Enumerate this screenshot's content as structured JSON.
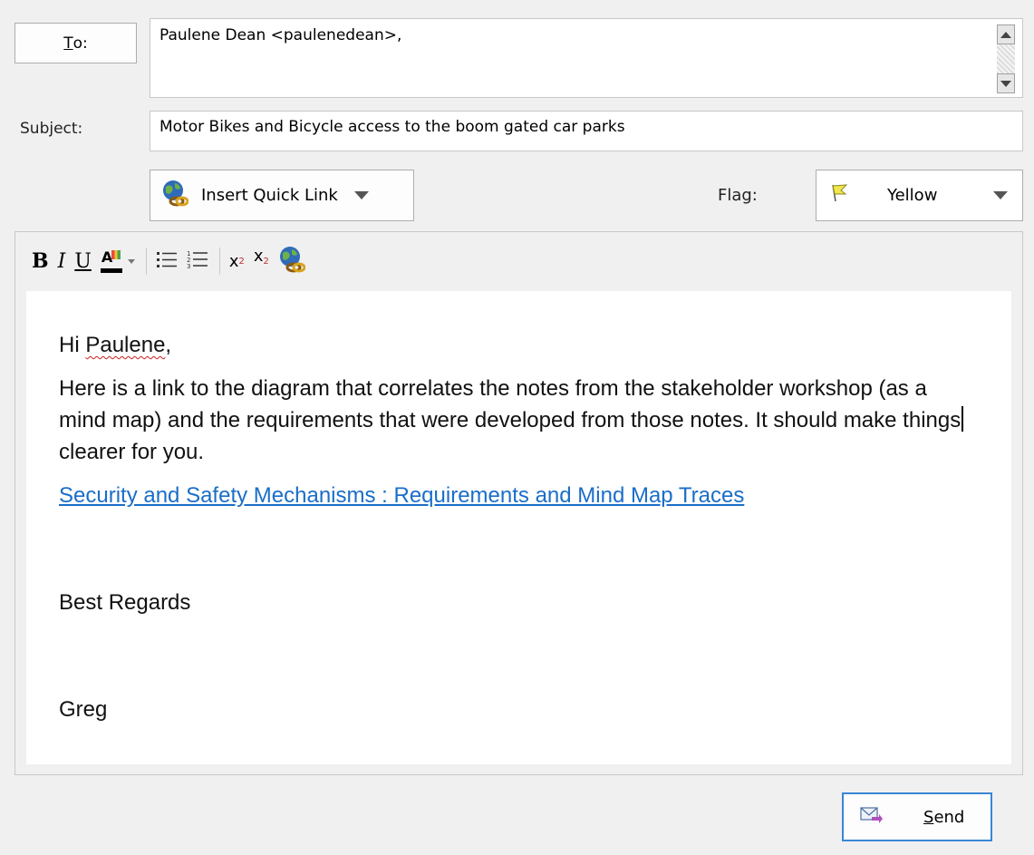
{
  "recipients": {
    "to_button_underlined": "T",
    "to_button_rest": "o:",
    "to_value": "Paulene Dean <paulenedean>,"
  },
  "subject": {
    "label": "Subject:",
    "value": "Motor Bikes and Bicycle access to the boom gated car parks"
  },
  "quick_link": {
    "label": "Insert Quick Link",
    "icon": "globe-link-icon"
  },
  "flag": {
    "label": "Flag:",
    "value": "Yellow",
    "color": "#f2e64a"
  },
  "format_toolbar": {
    "bold": "B",
    "italic": "I",
    "underline": "U",
    "font_color_glyph": "A",
    "superscript_x": "x",
    "superscript_n": "2",
    "subscript_x": "x",
    "subscript_n": "2"
  },
  "body": {
    "greeting_prefix": "Hi ",
    "greeting_name": "Paulene",
    "greeting_suffix": ",",
    "para_before_cursor": "Here is a link to the diagram that correlates the notes from the stakeholder workshop (as a mind map) and the requirements that were developed from those notes.  It should make things",
    "para_after_cursor": "clearer for you.",
    "link_text": "Security and Safety Mechanisms : Requirements and Mind Map Traces",
    "link_color": "#1a6ec8",
    "regards": "Best Regards",
    "signature": "Greg"
  },
  "send": {
    "label_underlined": "S",
    "label_rest": "end"
  }
}
